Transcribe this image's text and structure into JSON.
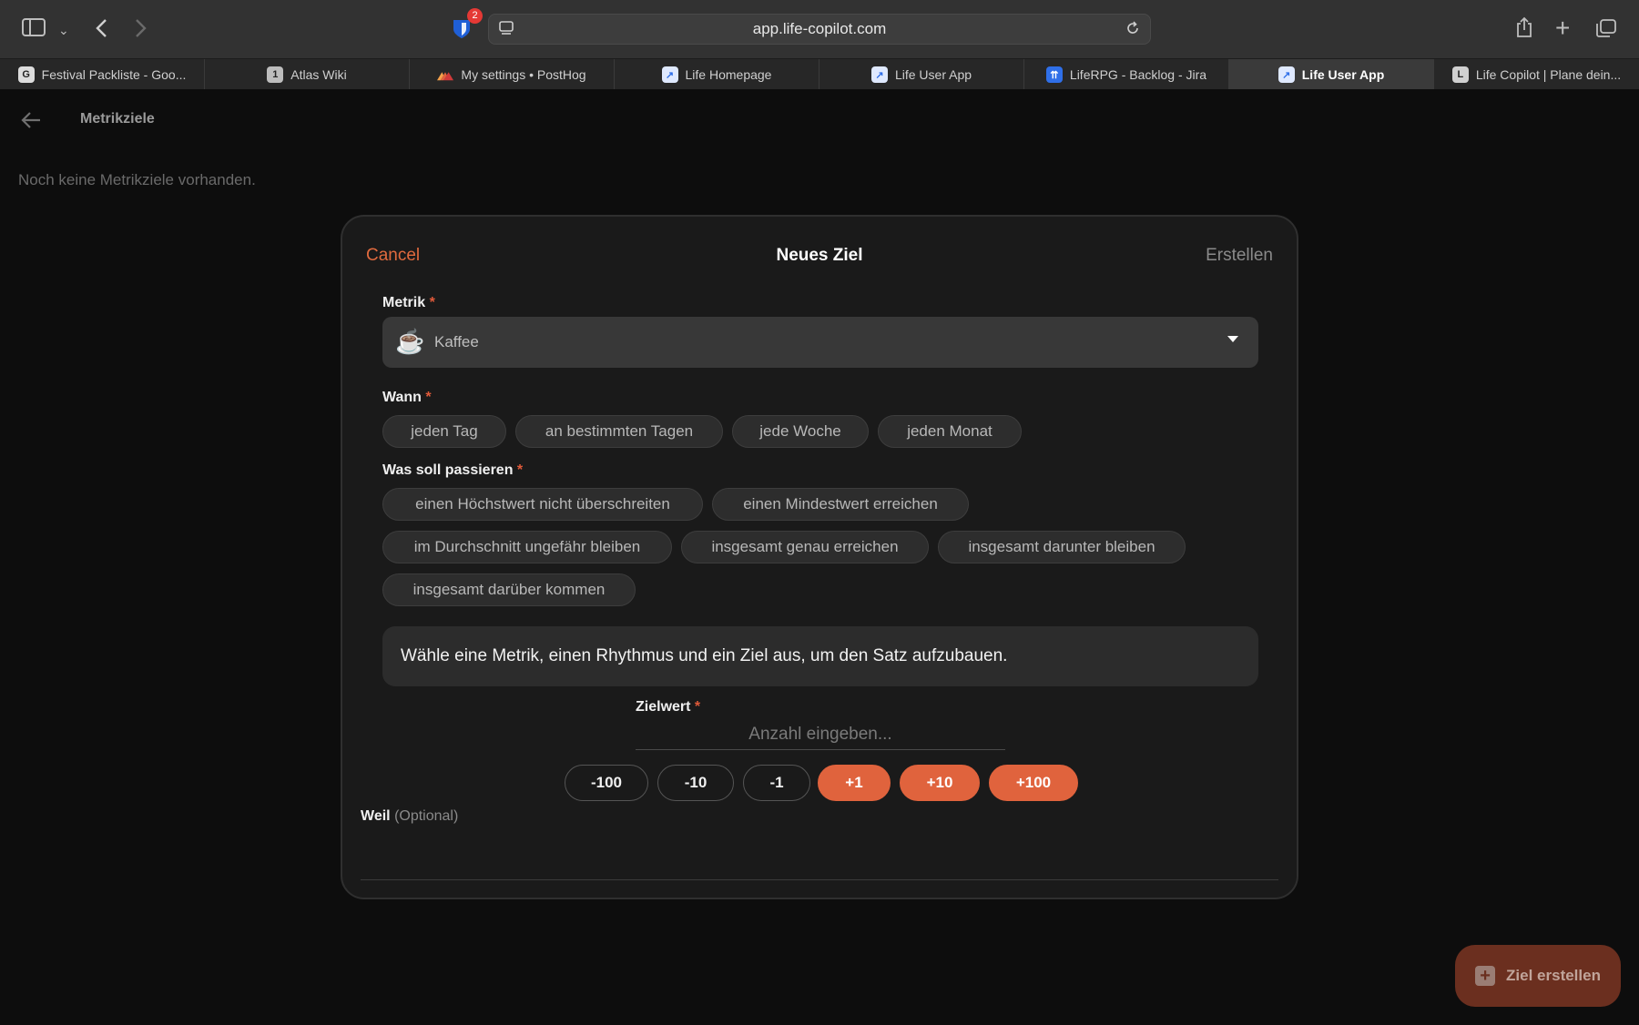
{
  "browser": {
    "url": "app.life-copilot.com",
    "extension_badge": "2",
    "tabs": [
      {
        "label": "Festival Packliste - Goo...",
        "fav": "G",
        "fav_color": "#dcdcdc",
        "active": false
      },
      {
        "label": "Atlas Wiki",
        "fav": "1",
        "fav_color": "#bdbdbd",
        "active": false
      },
      {
        "label": "My settings • PostHog",
        "fav": "",
        "fav_color": "#e0633d",
        "active": false
      },
      {
        "label": "Life Homepage",
        "fav": "",
        "fav_color": "#8fb8ff",
        "active": false
      },
      {
        "label": "Life User App",
        "fav": "",
        "fav_color": "#8fb8ff",
        "active": false
      },
      {
        "label": "LifeRPG - Backlog - Jira",
        "fav": "",
        "fav_color": "#2f6fe8",
        "active": false
      },
      {
        "label": "Life User App",
        "fav": "",
        "fav_color": "#8fb8ff",
        "active": true
      },
      {
        "label": "Life Copilot | Plane dein...",
        "fav": "L",
        "fav_color": "#d0d0d0",
        "active": false
      }
    ]
  },
  "page": {
    "title": "Metrikziele",
    "empty_text": "Noch keine Metrikziele vorhanden."
  },
  "modal": {
    "cancel": "Cancel",
    "title": "Neues Ziel",
    "create": "Erstellen",
    "metric_label": "Metrik",
    "required_mark": "*",
    "metric_value": "Kaffee",
    "metric_emoji": "☕",
    "when_label": "Wann",
    "when_options": [
      "jeden Tag",
      "an bestimmten Tagen",
      "jede Woche",
      "jeden Monat"
    ],
    "what_label": "Was soll passieren",
    "what_options": [
      "einen Höchstwert nicht überschreiten",
      "einen Mindestwert erreichen",
      "im Durchschnitt ungefähr bleiben",
      "insgesamt genau erreichen",
      "insgesamt darunter bleiben",
      "insgesamt darüber kommen"
    ],
    "info_text": "Wähle eine Metrik, einen Rhythmus und ein Ziel aus, um den Satz aufzubauen.",
    "target_label": "Zielwert",
    "target_placeholder": "Anzahl eingeben...",
    "steps": [
      "-100",
      "-10",
      "-1",
      "+1",
      "+10",
      "+100"
    ],
    "because_label": "Weil",
    "because_optional": "(Optional)"
  },
  "fab": {
    "label": "Ziel erstellen"
  },
  "colors": {
    "accent": "#e0633d",
    "background": "#0d0d0d",
    "modal": "#1a1a1a"
  }
}
